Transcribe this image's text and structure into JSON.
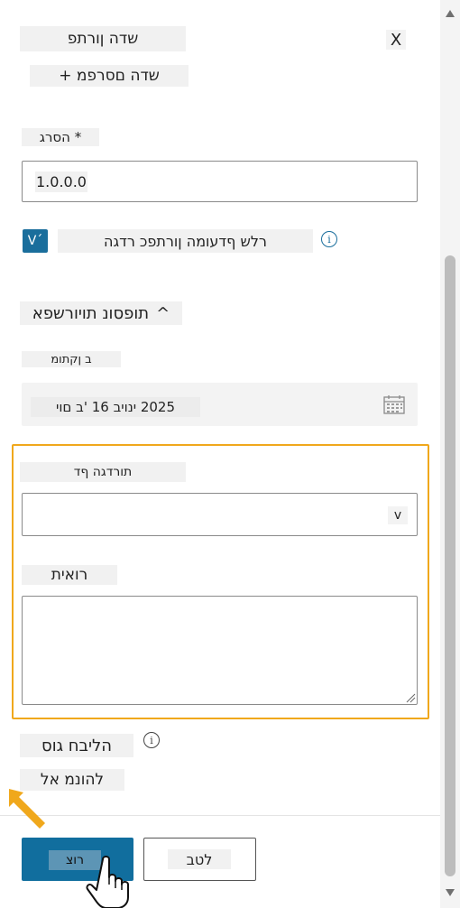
{
  "panel": {
    "title": "שדה ןורתפ",
    "close_label": "X",
    "add_field": "שדה םסרפמ +"
  },
  "version": {
    "label": "* הסרג",
    "value": "1.0.0.0"
  },
  "major_version": {
    "checkbox_glyph": "V´",
    "label": "רלש ףדעומה ןורתפכ רדגה",
    "info_glyph": "i"
  },
  "advanced": {
    "label": "תופסונ תויורשפא",
    "chevron": "^"
  },
  "date": {
    "label": "ב ןקתומ",
    "value": "2025 ינויב 16 'ב םוי"
  },
  "category": {
    "label": "תורדגה ףד",
    "chevron": "v"
  },
  "comment": {
    "label": "רואית"
  },
  "review": {
    "label": "הליבח גוס",
    "info_glyph": "i",
    "value": "להונמ אל"
  },
  "footer": {
    "create_label": "רוצ",
    "cancel_label": "לטב"
  },
  "colors": {
    "accent": "#116e9e",
    "highlight": "#f0a81c"
  }
}
